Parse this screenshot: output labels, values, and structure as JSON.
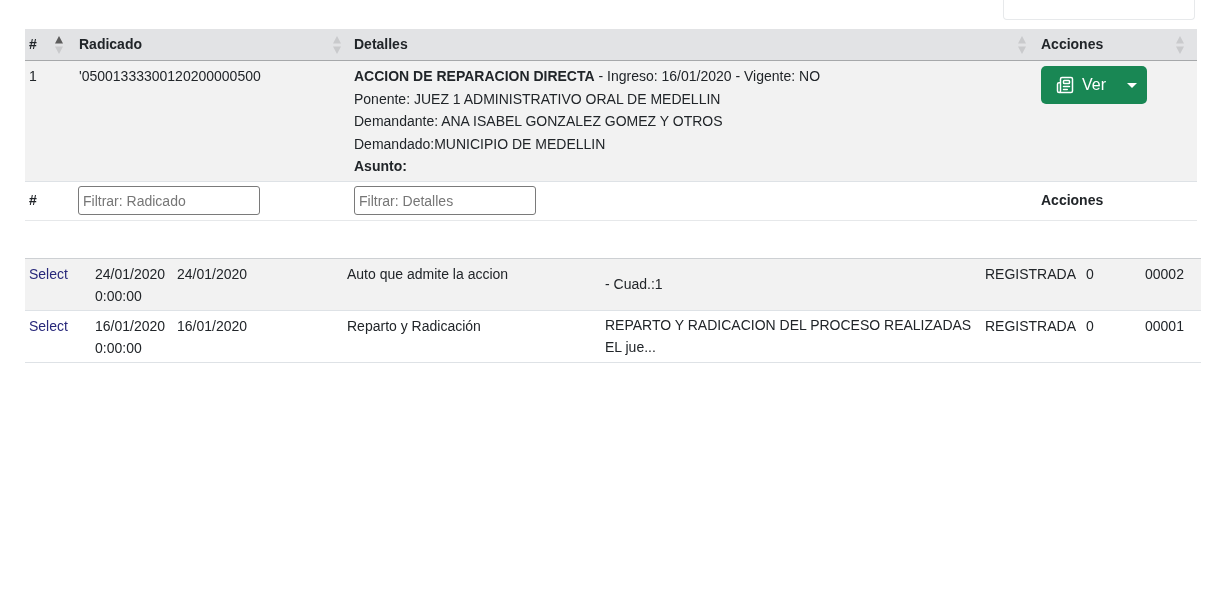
{
  "cases_table": {
    "columns": [
      {
        "label": "#",
        "sorted_ascending": true
      },
      {
        "label": "Radicado",
        "sorted_ascending": false
      },
      {
        "label": "Detalles",
        "sorted_ascending": false
      },
      {
        "label": "Acciones",
        "sorted_ascending": false
      }
    ],
    "rows": [
      {
        "number": "1",
        "radicado": "'05001333300120200000500",
        "details": [
          {
            "kind": "rich",
            "text": "**ACCION DE REPARACION DIRECTA** - Ingreso: 16/01/2020 - Vigente: NO"
          },
          {
            "kind": "plain",
            "text": "Ponente: JUEZ 1 ADMINISTRATIVO ORAL DE MEDELLIN"
          },
          {
            "kind": "plain",
            "text": "Demandante: ANA ISABEL GONZALEZ GOMEZ Y OTROS"
          },
          {
            "kind": "plain",
            "text": "Demandado:MUNICIPIO DE MEDELLIN"
          },
          {
            "kind": "bold",
            "text": "Asunto:"
          }
        ],
        "action_button": {
          "label": "Ver"
        }
      }
    ],
    "filter_row": [
      {
        "kind": "label",
        "text": "#"
      },
      {
        "kind": "filter",
        "placeholder": "Filtrar: Radicado"
      },
      {
        "kind": "filter",
        "placeholder": "Filtrar: Detalles"
      },
      {
        "kind": "label",
        "text": "Acciones"
      }
    ]
  },
  "actuaciones_table": {
    "rows": [
      {
        "link": "Select",
        "cells": [
          "24/01/2020 0:00:00",
          "24/01/2020",
          "Auto que admite la accion",
          "- Cuad.:1",
          "REGISTRADA",
          "0",
          "00002"
        ]
      },
      {
        "link": "Select",
        "cells": [
          "16/01/2020 0:00:00",
          "16/01/2020",
          "Reparto y Radicación",
          "REPARTO Y RADICACION DEL PROCESO REALIZADAS EL jue...",
          "REGISTRADA",
          "0",
          "00001"
        ]
      }
    ]
  }
}
